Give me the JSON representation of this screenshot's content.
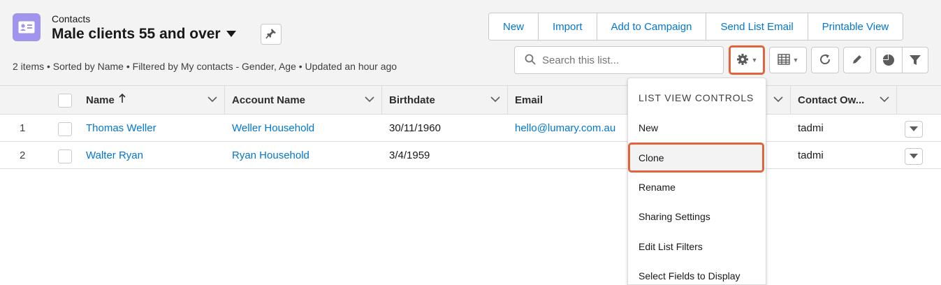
{
  "header": {
    "object_label": "Contacts",
    "list_title": "Male clients 55 and over",
    "meta": "2 items • Sorted by Name • Filtered by My contacts - Gender, Age • Updated an hour ago"
  },
  "actions": {
    "new": "New",
    "import": "Import",
    "add_to_campaign": "Add to Campaign",
    "send_list_email": "Send List Email",
    "printable_view": "Printable View"
  },
  "search": {
    "placeholder": "Search this list..."
  },
  "columns": [
    "Name",
    "Account Name",
    "Birthdate",
    "Email",
    "Contact Ow..."
  ],
  "rows": [
    {
      "num": "1",
      "name": "Thomas Weller",
      "account": "Weller Household",
      "birthdate": "30/11/1960",
      "email": "hello@lumary.com.au",
      "owner": "tadmi"
    },
    {
      "num": "2",
      "name": "Walter Ryan",
      "account": "Ryan Household",
      "birthdate": "3/4/1959",
      "email": "",
      "owner": "tadmi"
    }
  ],
  "menu": {
    "heading": "LIST VIEW CONTROLS",
    "items": [
      "New",
      "Clone",
      "Rename",
      "Sharing Settings",
      "Edit List Filters",
      "Select Fields to Display"
    ]
  },
  "colors": {
    "accent": "#0176d3",
    "highlight": "#e0643e",
    "object_icon": "#a094ed"
  }
}
